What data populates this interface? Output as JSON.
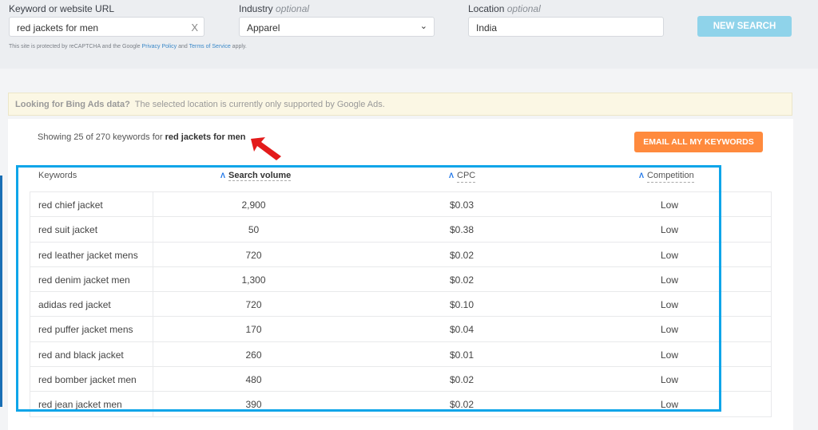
{
  "search": {
    "keyword_label": "Keyword or website URL",
    "keyword_value": "red jackets for men",
    "clear": "X",
    "industry_label": "Industry",
    "industry_optional": "optional",
    "industry_value": "Apparel",
    "location_label": "Location",
    "location_optional": "optional",
    "location_value": "India",
    "new_search": "NEW SEARCH",
    "note_pre": "This site is protected by reCAPTCHA and the Google",
    "privacy": "Privacy Policy",
    "and": "and",
    "terms": "Terms of Service",
    "apply": "apply."
  },
  "banner": {
    "title": "Looking for Bing Ads data?",
    "text": "The selected location is currently only supported by Google Ads."
  },
  "results": {
    "showing": "Showing 25 of 270 keywords for",
    "query": "red jackets for men",
    "email_button": "EMAIL ALL MY KEYWORDS"
  },
  "table": {
    "headers": [
      "Keywords",
      "Search volume",
      "CPC",
      "Competition"
    ],
    "rows": [
      [
        "red chief jacket",
        "2,900",
        "$0.03",
        "Low"
      ],
      [
        "red suit jacket",
        "50",
        "$0.38",
        "Low"
      ],
      [
        "red leather jacket mens",
        "720",
        "$0.02",
        "Low"
      ],
      [
        "red denim jacket men",
        "1,300",
        "$0.02",
        "Low"
      ],
      [
        "adidas red jacket",
        "720",
        "$0.10",
        "Low"
      ],
      [
        "red puffer jacket mens",
        "170",
        "$0.04",
        "Low"
      ],
      [
        "red and black jacket",
        "260",
        "$0.01",
        "Low"
      ],
      [
        "red bomber jacket men",
        "480",
        "$0.02",
        "Low"
      ],
      [
        "red jean jacket men",
        "390",
        "$0.02",
        "Low"
      ]
    ]
  },
  "colors": {
    "highlight": "#0ea5e9",
    "email": "#ff8a3d",
    "new_search": "#8fd3ea",
    "arrow": "#e31b1b"
  }
}
